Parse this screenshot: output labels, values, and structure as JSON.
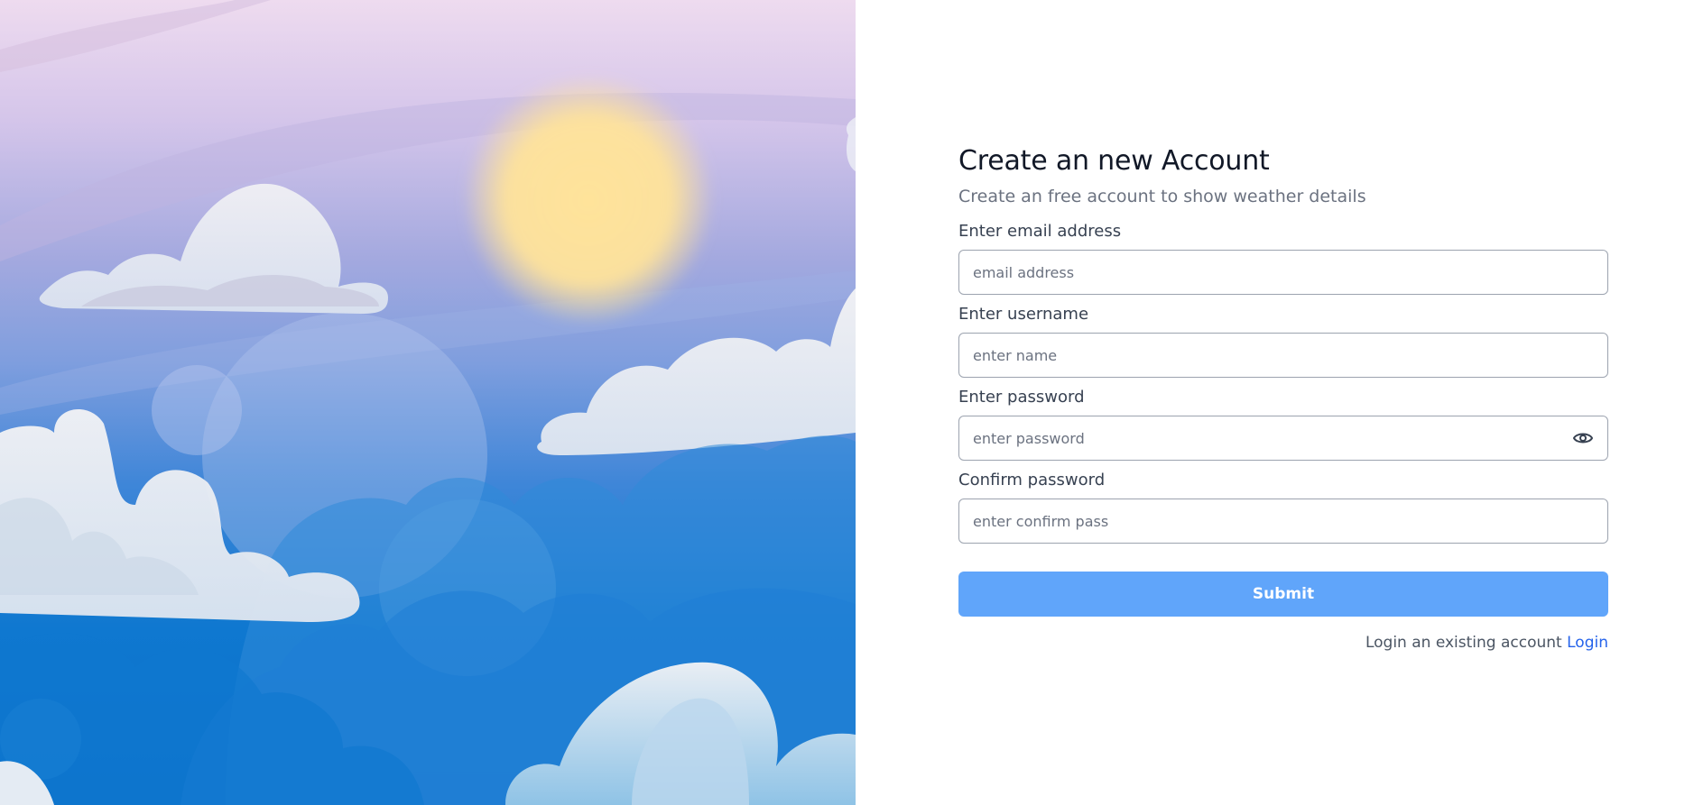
{
  "illustration": {
    "description_icon": "sky-clouds-sun-illustration",
    "colors": {
      "sky_top": "#e9d6ec",
      "sky_mid": "#9fa9de",
      "sky_low": "#1f7fd6",
      "sun": "#ffe08a",
      "cloud": "#eef1f5"
    }
  },
  "form": {
    "title": "Create an new Account",
    "subtitle": "Create an free account to show weather details",
    "fields": [
      {
        "label": "Enter email address",
        "placeholder": "email address",
        "value": ""
      },
      {
        "label": "Enter username",
        "placeholder": "enter name",
        "value": ""
      },
      {
        "label": "Enter password",
        "placeholder": "enter password",
        "value": "",
        "icon": "eye-icon"
      },
      {
        "label": "Confirm password",
        "placeholder": "enter confirm pass",
        "value": ""
      }
    ],
    "submit_label": "Submit",
    "login_prompt": "Login an existing account",
    "login_link": "Login",
    "accent_color": "#60a5fa",
    "link_color": "#2563eb"
  }
}
